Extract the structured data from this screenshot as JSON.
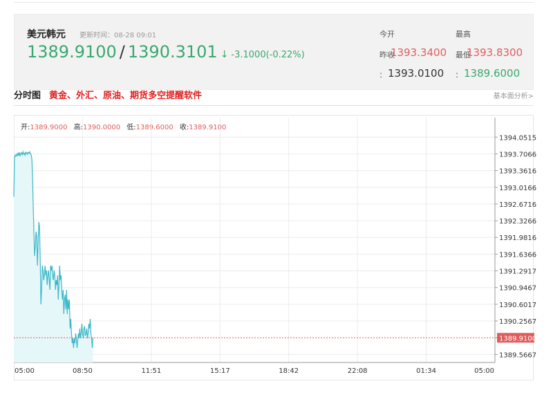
{
  "header": {
    "name": "美元韩元",
    "update_label": "更新时间：",
    "update_time": "08-28 09:01",
    "bid": "1389.9100",
    "separator": "/",
    "ask": "1390.3101",
    "arrow": "↓",
    "change": "-3.1000(-0.22%)"
  },
  "stats": {
    "open_label": "今开",
    "open_value": "1393.3400",
    "high_label": "最高",
    "high_value": "1393.8300",
    "prev_close_label": "昨收",
    "prev_close_value": "1393.0100",
    "low_label": "最低",
    "low_value": "1389.6000",
    "colon": ":"
  },
  "section": {
    "title": "分时图",
    "link": "黄金、外汇、原油、期货多空提醒软件",
    "right_link": "基本面分析>"
  },
  "ohlc": {
    "open_label": "开:",
    "open": "1389.9000",
    "high_label": "高:",
    "high": "1390.0000",
    "low_label": "低:",
    "low": "1389.6000",
    "close_label": "收:",
    "close": "1389.9100"
  },
  "colors": {
    "up": "#e05c5c",
    "down": "#3aa76d",
    "line": "#3bb8c8",
    "area": "#e6f7fa",
    "ref_line": "#e05c5c"
  },
  "chart_data": {
    "type": "area",
    "title": "",
    "xlabel": "",
    "ylabel": "",
    "x_ticks": [
      "05:00",
      "08:50",
      "11:51",
      "15:17",
      "18:42",
      "22:08",
      "01:34",
      "05:00"
    ],
    "y_ticks": [
      "1394.0515",
      "1393.7066",
      "1393.3616",
      "1393.0166",
      "1392.6716",
      "1392.3266",
      "1391.9816",
      "1391.6366",
      "1391.2917",
      "1390.9467",
      "1390.6017",
      "1390.2567",
      "1389.9100",
      "1389.5667"
    ],
    "ylim": [
      1389.4,
      1394.17
    ],
    "xlim": [
      0,
      693
    ],
    "grid": true,
    "current_price": 1389.91,
    "series": [
      {
        "x": [
          0,
          1,
          2,
          3,
          4,
          5,
          6,
          7,
          8,
          9,
          10,
          11,
          12,
          13,
          14,
          15,
          16,
          17,
          18,
          19,
          20,
          21,
          22,
          23,
          24,
          25,
          26,
          27,
          28,
          29,
          30,
          31,
          32,
          33,
          34,
          35,
          36,
          37,
          38,
          39,
          40,
          41,
          42,
          43,
          44,
          45,
          46,
          47,
          48,
          49,
          50,
          51,
          52,
          53,
          54,
          55,
          56,
          57,
          58,
          59,
          60,
          61,
          62,
          63,
          64,
          65,
          66,
          67,
          68,
          69,
          70,
          71,
          72,
          73,
          74,
          75,
          76,
          77,
          78,
          79,
          80,
          81,
          82,
          83,
          84,
          85,
          86,
          87,
          88,
          89,
          90,
          91,
          92,
          93,
          94,
          95,
          96,
          97,
          98,
          99,
          100,
          101,
          102,
          103,
          104,
          105,
          106,
          107,
          108,
          109,
          110,
          111,
          112,
          113,
          114
        ],
        "values": [
          1392.82,
          1393.62,
          1393.68,
          1393.66,
          1393.7,
          1393.67,
          1393.72,
          1393.68,
          1393.74,
          1393.66,
          1393.71,
          1393.73,
          1393.69,
          1393.75,
          1393.7,
          1393.72,
          1393.68,
          1393.74,
          1393.71,
          1393.73,
          1393.7,
          1393.74,
          1393.72,
          1393.75,
          1393.71,
          1393.69,
          1393.6,
          1393.2,
          1392.6,
          1392.05,
          1391.6,
          1391.8,
          1392.1,
          1392.0,
          1391.4,
          1391.9,
          1392.3,
          1392.2,
          1391.5,
          1390.6,
          1390.9,
          1391.4,
          1391.3,
          1391.1,
          1391.2,
          1391.4,
          1391.2,
          1391.3,
          1391.0,
          1391.2,
          1391.3,
          1391.1,
          1390.9,
          1391.4,
          1391.3,
          1391.4,
          1391.2,
          1391.1,
          1391.3,
          1391.2,
          1390.9,
          1391.1,
          1391.0,
          1391.2,
          1390.7,
          1391.0,
          1391.4,
          1391.1,
          1391.2,
          1390.9,
          1390.7,
          1390.9,
          1390.4,
          1390.7,
          1390.8,
          1390.5,
          1390.9,
          1390.4,
          1390.7,
          1390.5,
          1390.7,
          1390.1,
          1390.3,
          1390.0,
          1389.8,
          1389.9,
          1389.7,
          1389.9,
          1389.8,
          1390.0,
          1389.9,
          1389.7,
          1389.85,
          1390.0,
          1389.9,
          1390.1,
          1389.9,
          1390.0,
          1390.2,
          1390.0,
          1389.9,
          1390.1,
          1390.15,
          1389.95,
          1390.0,
          1390.1,
          1389.9,
          1390.0,
          1390.2,
          1390.1,
          1390.3,
          1390.0,
          1389.9,
          1389.7,
          1389.91
        ]
      }
    ]
  }
}
